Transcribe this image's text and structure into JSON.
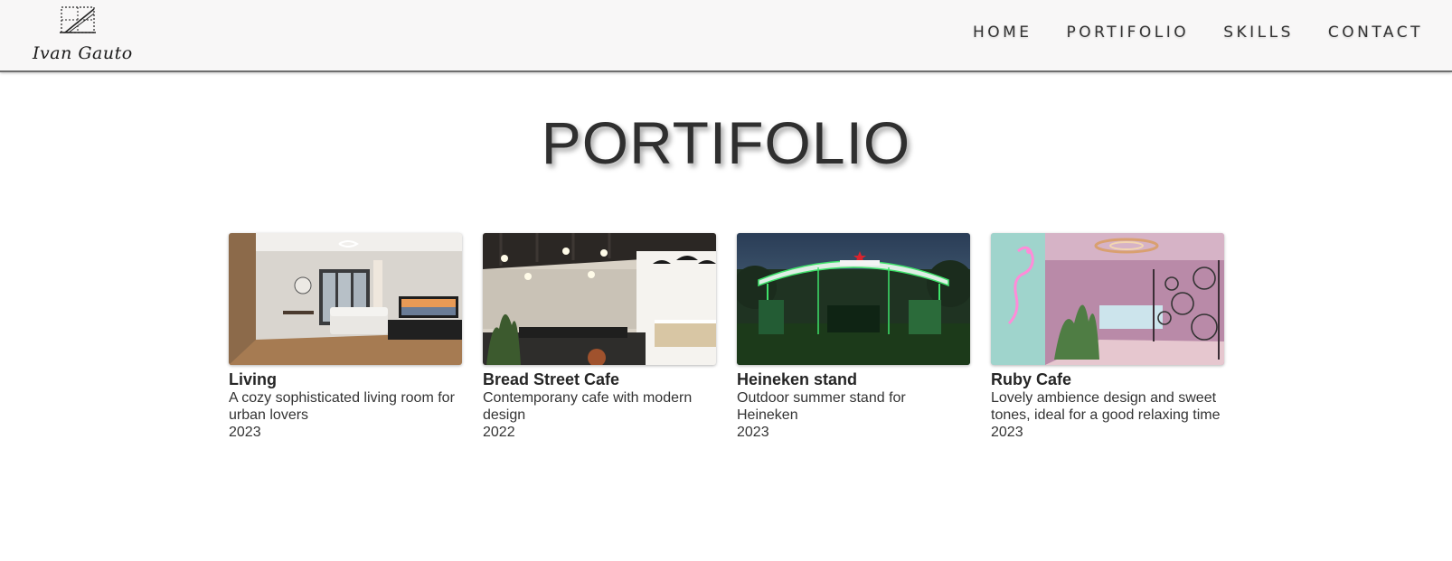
{
  "brand": {
    "signature": "Ivan Gauto"
  },
  "nav": {
    "items": [
      {
        "label": "HOME"
      },
      {
        "label": "PORTIFOLIO"
      },
      {
        "label": "SKILLS"
      },
      {
        "label": "CONTACT"
      }
    ]
  },
  "page": {
    "title": "PORTIFOLIO"
  },
  "projects": [
    {
      "title": "Living",
      "description": "A cozy sophisticated living room for urban lovers",
      "year": "2023",
      "image": "living-room-render"
    },
    {
      "title": "Bread Street Cafe",
      "description": "Contemporany cafe with modern design",
      "year": "2022",
      "image": "cafe-interior-render"
    },
    {
      "title": "Heineken stand",
      "description": "Outdoor summer stand for Heineken",
      "year": "2023",
      "image": "heineken-stand-render"
    },
    {
      "title": "Ruby Cafe",
      "description": "Lovely ambience design and sweet tones, ideal for a good relaxing time",
      "year": "2023",
      "image": "pink-cafe-render"
    }
  ],
  "colors": {
    "navbar_bg": "#f8f7f7",
    "text": "#333333",
    "heineken_green": "#3fe26a",
    "ruby_pink": "#e9a4c4"
  }
}
